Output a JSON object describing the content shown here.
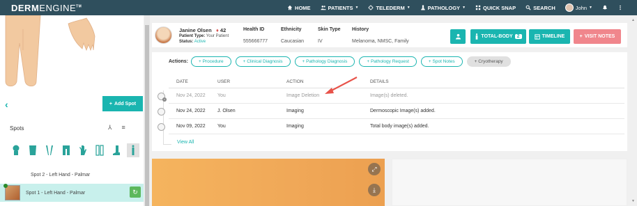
{
  "nav": {
    "logo_bold": "DERM",
    "logo_thin": "ENGINE",
    "logo_tm": "TM",
    "items": [
      {
        "label": "HOME",
        "icon": "home-icon"
      },
      {
        "label": "PATIENTS",
        "icon": "patients-icon",
        "caret": true
      },
      {
        "label": "TELEDERM",
        "icon": "telederm-icon",
        "caret": true
      },
      {
        "label": "PATHOLOGY",
        "icon": "microscope-icon",
        "caret": true
      },
      {
        "label": "QUICK SNAP",
        "icon": "grid-icon"
      },
      {
        "label": "SEARCH",
        "icon": "search-icon"
      },
      {
        "label": "John",
        "icon": "avatar",
        "caret": true
      }
    ]
  },
  "left": {
    "add_spot_label": "Add Spot",
    "spots_title": "Spots",
    "spots": [
      {
        "label": "Spot 2 - Left Hand - Palmar"
      },
      {
        "label": "Spot 1 - Left Hand - Palmar"
      }
    ]
  },
  "patient": {
    "name": "Janine Olsen",
    "age": "42",
    "type_label": "Patient Type:",
    "type_value": "Your Patient",
    "status_label": "Status:",
    "status_value": "Active",
    "health_id_label": "Health ID",
    "health_id_value": "555666777",
    "ethnicity_label": "Ethnicity",
    "ethnicity_value": "Caucasian",
    "skin_type_label": "Skin Type",
    "skin_type_value": "IV",
    "history_label": "History",
    "history_value": "Melanoma, NMSC, Family"
  },
  "buttons": {
    "total_body_label": "TOTAL-BODY",
    "total_body_count": "2",
    "timeline_label": "TIMELINE",
    "visit_notes_label": "VISIT NOTES"
  },
  "actions": {
    "label": "Actions:",
    "pills": [
      "+ Procedure",
      "+ Clinical Diagnosis",
      "+ Pathology Diagnosis",
      "+ Pathology Request",
      "+ Spot Notes",
      "+ Cryotherapy"
    ]
  },
  "table": {
    "headers": [
      "DATE",
      "USER",
      "ACTION",
      "DETAILS"
    ],
    "rows": [
      {
        "date": "Nov 24, 2022",
        "user": "You",
        "action": "Image Deletion",
        "details": "Image(s) deleted.",
        "faded": true
      },
      {
        "date": "Nov 24, 2022",
        "user": "J. Olsen",
        "action": "Imaging",
        "details": "Dermoscopic Image(s) added.",
        "faded": false
      },
      {
        "date": "Nov 09, 2022",
        "user": "You",
        "action": "Imaging",
        "details": "Total body image(s) added.",
        "faded": false
      }
    ],
    "view_all": "View All"
  },
  "colors": {
    "nav_bg": "#2f4f5d",
    "accent": "#1ab5b0",
    "visit_notes": "#f0868c",
    "arrow": "#e8534a"
  }
}
